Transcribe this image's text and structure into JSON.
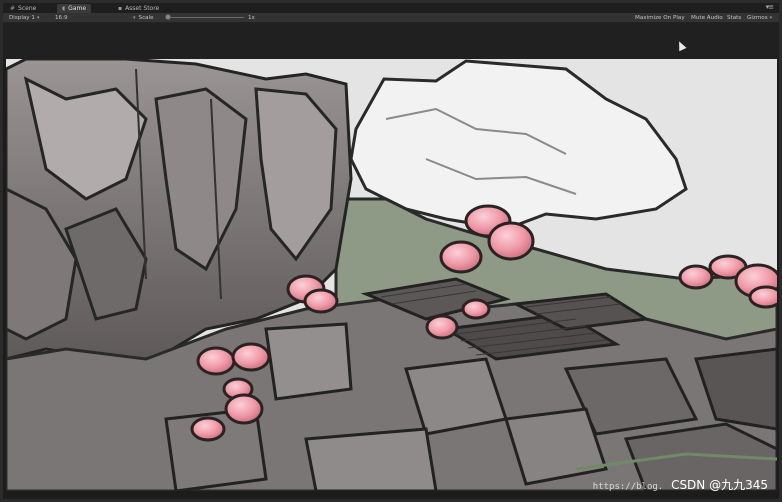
{
  "tabs": [
    {
      "label": "Scene",
      "icon": "scene-grid-icon",
      "active": false
    },
    {
      "label": "Game",
      "icon": "game-pacman-icon",
      "active": true
    },
    {
      "label": "Asset Store",
      "icon": "asset-store-icon",
      "active": false
    }
  ],
  "tab_menu_glyph": "▾≡",
  "toolbar": {
    "display": "Display 1",
    "aspect": "16:9",
    "scale_label": "Scale",
    "scale_value": "1x",
    "scale_level": 0.02,
    "maximize": "Maximize On Play",
    "mute": "Mute Audio",
    "stats": "Stats",
    "gizmos": "Gizmos"
  },
  "watermark": {
    "url": "https://blog.",
    "text": "CSDN @九九345"
  },
  "colors": {
    "blossom": "#f09aa8",
    "sky": "#e6e6e6",
    "ink": "#2a2a2a"
  }
}
